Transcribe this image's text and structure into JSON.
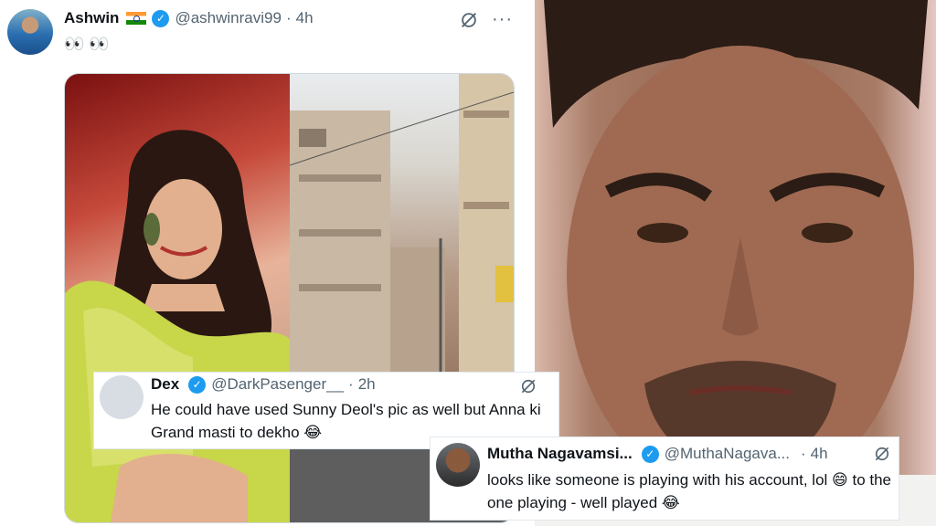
{
  "main_tweet": {
    "name": "Ashwin",
    "handle": "@ashwinravi99",
    "time": "4h",
    "separator": "·",
    "more": "···",
    "text": "👀 👀"
  },
  "replies": [
    {
      "name": "Dex",
      "handle": "@DarkPasenger__",
      "separator": "·",
      "time": "2h",
      "text": "He could have used Sunny Deol's pic as well but Anna ki Grand masti to dekho 😂"
    },
    {
      "name": "Mutha Nagavamsi...",
      "handle": "@MuthaNagava...",
      "separator": "·",
      "time": "4h",
      "text": "looks like someone is playing with his account, lol 😄 to the one playing - well played 😂"
    }
  ],
  "icons": {
    "verified": "verified-badge-icon",
    "grok": "grok-slash-icon",
    "more": "more-options-icon"
  },
  "colors": {
    "verified_blue": "#1d9bf0",
    "muted_text": "#536471"
  }
}
